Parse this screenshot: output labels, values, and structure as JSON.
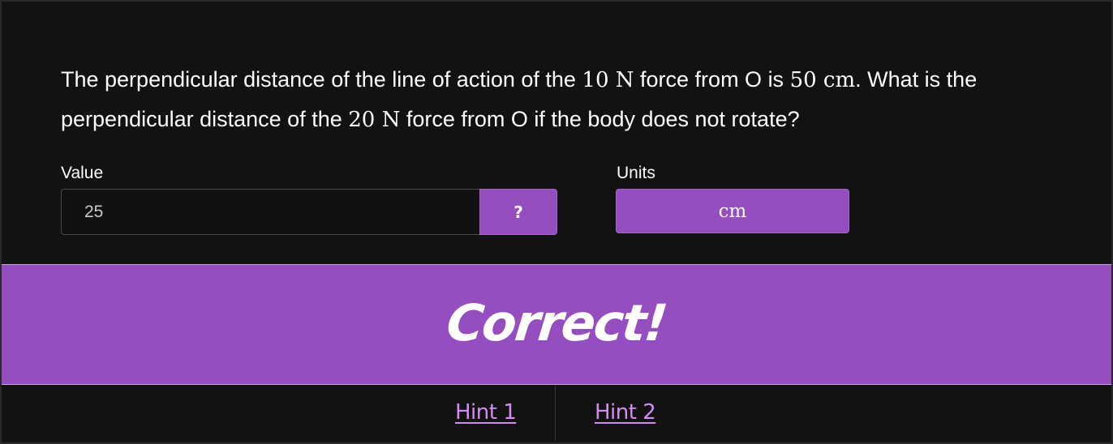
{
  "question": {
    "part1": "The perpendicular distance of the line of action of the ",
    "math1": "10 N",
    "part2": " force from O is ",
    "math2": "50 cm",
    "part3": ". What is the perpendicular distance of the ",
    "math3": "20 N",
    "part4": " force from O if the body does not rotate?"
  },
  "answer": {
    "value_label": "Value",
    "value": "25",
    "help_label": "?",
    "units_label": "Units",
    "units_value": "cm"
  },
  "feedback": {
    "text": "Correct!"
  },
  "hints": [
    {
      "label": "Hint 1"
    },
    {
      "label": "Hint 2"
    }
  ],
  "colors": {
    "background": "#121212",
    "accent": "#954ec0",
    "link": "#d48cf2",
    "text": "#ffffff"
  }
}
